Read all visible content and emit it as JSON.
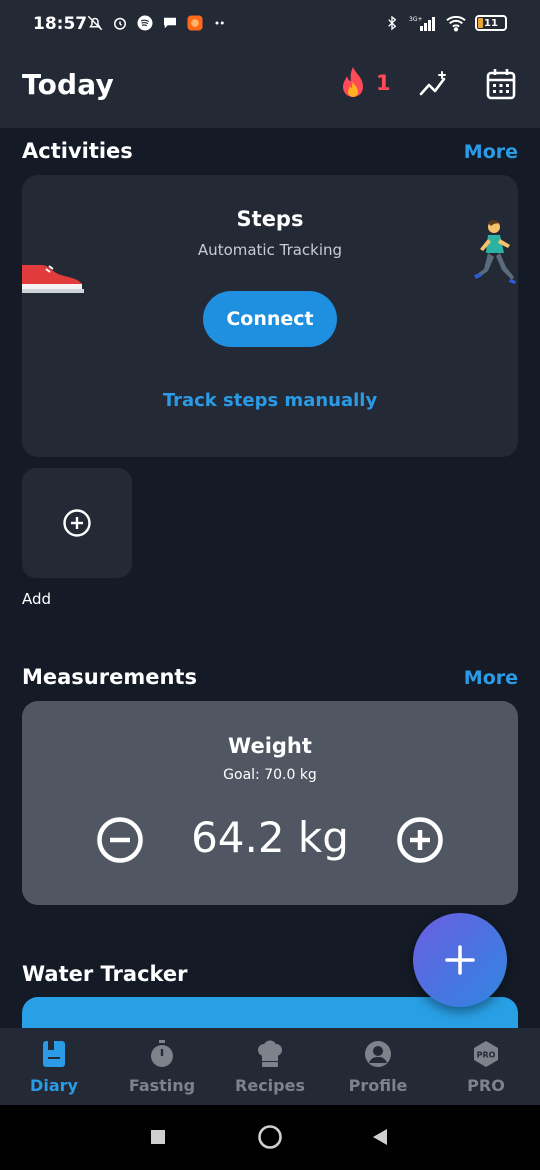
{
  "status_bar": {
    "time": "18:57",
    "battery": "11",
    "left_icons": [
      "mute-bell-icon",
      "alarm-icon",
      "spotify-icon",
      "chat-bubble-icon",
      "app-notification-icon",
      "more-dots-icon"
    ],
    "right_icons": [
      "bluetooth-icon",
      "signal-icon",
      "wifi-icon",
      "battery-icon"
    ],
    "network_label": "3G+"
  },
  "header": {
    "title": "Today",
    "streak_count": "1",
    "icons": [
      "flame-icon",
      "stats-chart-icon",
      "calendar-icon"
    ]
  },
  "activities": {
    "title": "Activities",
    "more": "More",
    "steps": {
      "title": "Steps",
      "subtitle": "Automatic Tracking",
      "connect_label": "Connect",
      "manual_link": "Track steps manually"
    },
    "add_label": "Add"
  },
  "measurements": {
    "title": "Measurements",
    "more": "More",
    "weight": {
      "title": "Weight",
      "goal": "Goal: 70.0 kg",
      "value": "64.2 kg"
    }
  },
  "water": {
    "title": "Water Tracker"
  },
  "colors": {
    "background": "#141b27",
    "card": "#232935",
    "weight_card": "#505763",
    "accent": "#2b9be6",
    "streak": "#ff4a57",
    "water": "#29a0e6"
  },
  "bottom_nav": {
    "items": [
      {
        "label": "Diary",
        "icon": "diary-icon",
        "active": true
      },
      {
        "label": "Fasting",
        "icon": "stopwatch-icon",
        "active": false
      },
      {
        "label": "Recipes",
        "icon": "chef-hat-icon",
        "active": false
      },
      {
        "label": "Profile",
        "icon": "profile-icon",
        "active": false
      },
      {
        "label": "PRO",
        "icon": "pro-badge-icon",
        "active": false
      }
    ],
    "pro_badge_text": "PRO"
  }
}
